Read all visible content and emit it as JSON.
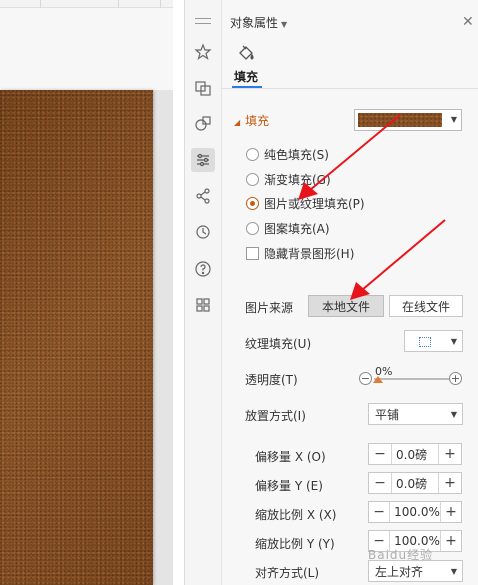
{
  "panel": {
    "title": "对象属性",
    "tab_label": "填充",
    "section_label": "填充"
  },
  "fill_options": [
    {
      "label": "纯色填充(S)",
      "selected": false
    },
    {
      "label": "渐变填充(G)",
      "selected": false
    },
    {
      "label": "图片或纹理填充(P)",
      "selected": true
    },
    {
      "label": "图案填充(A)",
      "selected": false
    }
  ],
  "hide_background": {
    "label": "隐藏背景图形(H)",
    "checked": false
  },
  "picture_source": {
    "label": "图片来源",
    "local_button": "本地文件",
    "online_button": "在线文件"
  },
  "texture_fill": {
    "label": "纹理填充(U)"
  },
  "transparency": {
    "label": "透明度(T)",
    "value_text": "0%",
    "value": 0
  },
  "placement": {
    "label": "放置方式(I)",
    "value": "平铺"
  },
  "offset_x": {
    "label": "偏移量 X (O)",
    "value": "0.0磅"
  },
  "offset_y": {
    "label": "偏移量 Y (E)",
    "value": "0.0磅"
  },
  "scale_x": {
    "label": "缩放比例 X (X)",
    "value": "100.0%"
  },
  "scale_y": {
    "label": "缩放比例 Y (Y)",
    "value": "100.0%"
  },
  "alignment": {
    "label": "对齐方式(L)",
    "value": "左上对齐"
  },
  "rail_icons": [
    "drag-handle-icon",
    "star-shape-icon",
    "swap-icon",
    "shapes-icon",
    "settings-sliders-icon",
    "share-icon",
    "history-icon",
    "help-icon",
    "grid-apps-icon"
  ],
  "colors": {
    "accent": "#c55a11",
    "arrow": "#e8141b",
    "texture": "#8a5224"
  },
  "watermark": "Baidu经验"
}
